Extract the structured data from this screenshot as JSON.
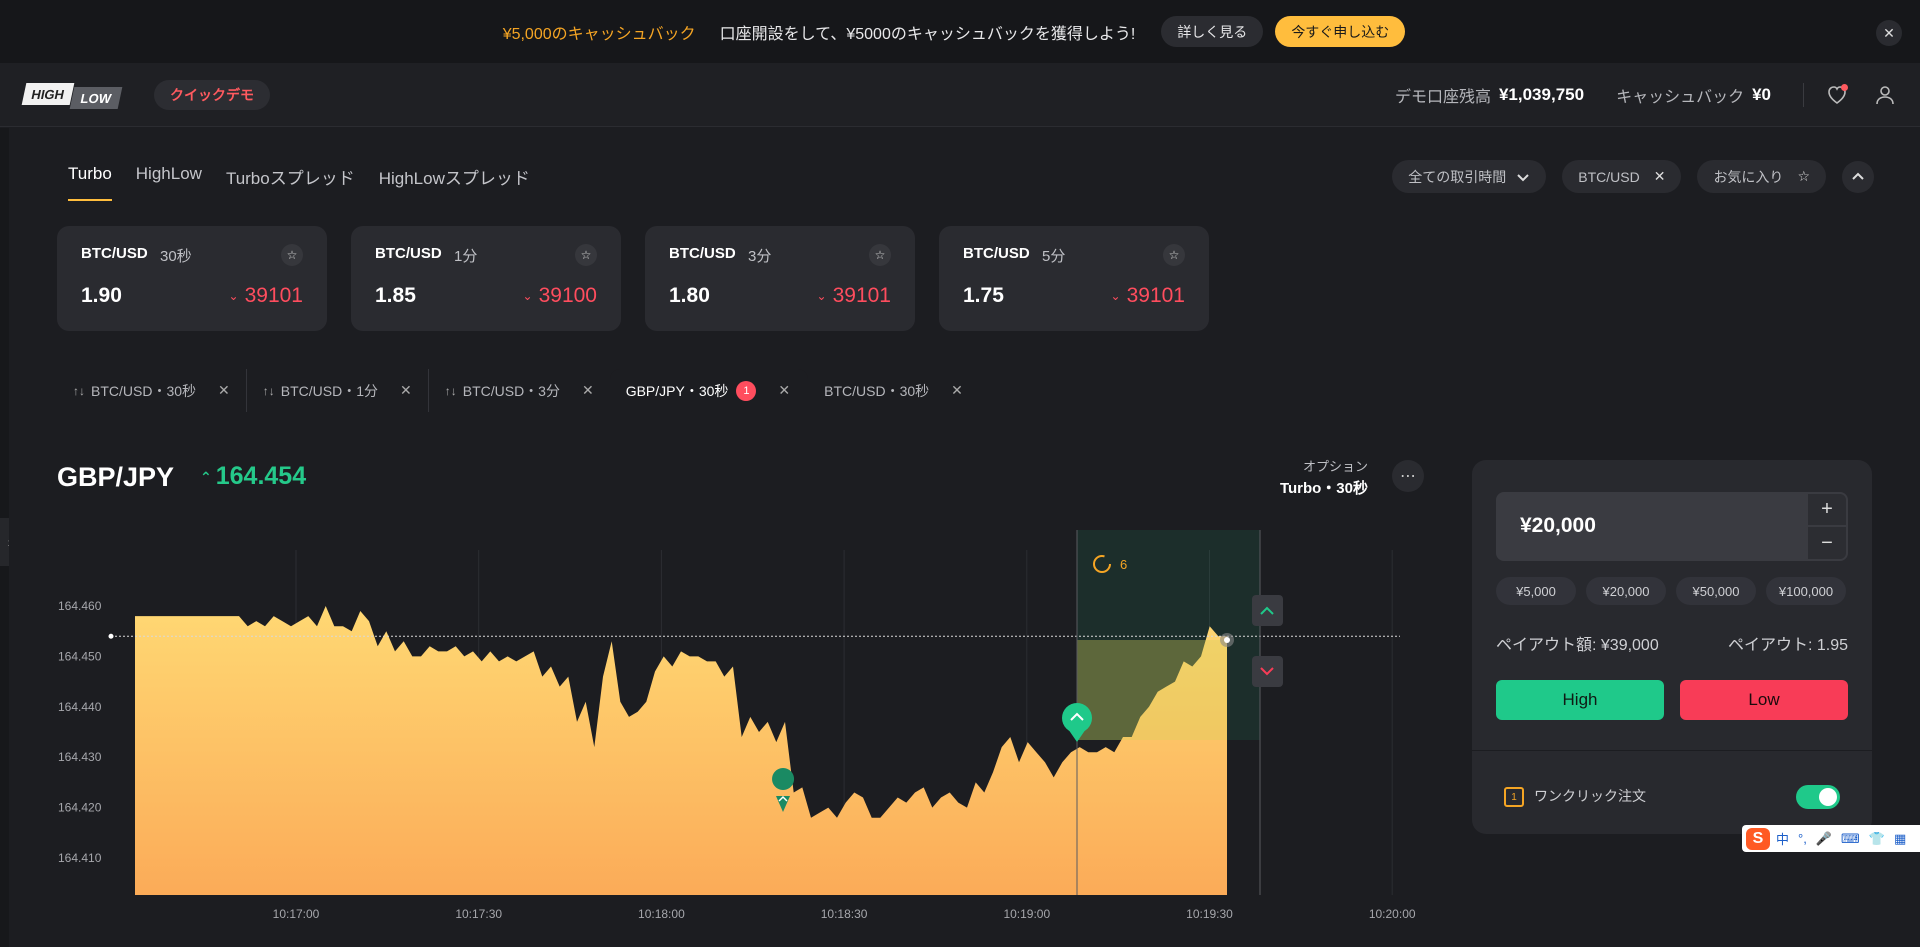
{
  "promo": {
    "title": "¥5,000のキャッシュバック",
    "text": "口座開設をして、¥5000のキャッシュバックを獲得しよう!",
    "details_label": "詳しく見る",
    "apply_label": "今すぐ申し込む",
    "close_label": "✕"
  },
  "header": {
    "logo_high": "HIGH",
    "logo_low": "LOW",
    "quick_demo_label": "クイックデモ",
    "balance_label": "デモ口座残高",
    "balance_value": "¥1,039,750",
    "cashback_label": "キャッシュバック",
    "cashback_value": "¥0"
  },
  "game_tabs": [
    {
      "label": "Turbo",
      "active": true
    },
    {
      "label": "HighLow",
      "active": false
    },
    {
      "label": "Turboスプレッド",
      "active": false
    },
    {
      "label": "HighLowスプレッド",
      "active": false
    }
  ],
  "filters": {
    "time_label": "全ての取引時間",
    "asset_label": "BTC/USD",
    "favorites_label": "お気に入り"
  },
  "cards": [
    {
      "asset": "BTC/USD",
      "duration": "30秒",
      "payout": "1.90",
      "price": "39101"
    },
    {
      "asset": "BTC/USD",
      "duration": "1分",
      "payout": "1.85",
      "price": "39100"
    },
    {
      "asset": "BTC/USD",
      "duration": "3分",
      "payout": "1.80",
      "price": "39101"
    },
    {
      "asset": "BTC/USD",
      "duration": "5分",
      "payout": "1.75",
      "price": "39101"
    }
  ],
  "chart_tabs": [
    {
      "label": "BTC/USD・30秒"
    },
    {
      "label": "BTC/USD・1分"
    },
    {
      "label": "BTC/USD・3分"
    },
    {
      "label": "GBP/JPY・30秒",
      "badge": "1",
      "active": true
    },
    {
      "label": "BTC/USD・30秒"
    }
  ],
  "chart_header": {
    "asset": "GBP/JPY",
    "price": "164.454",
    "option_label": "オプション",
    "option_value": "Turbo・30秒",
    "countdown": "6"
  },
  "chart_data": {
    "type": "area",
    "y_ticks": [
      "164.460",
      "164.450",
      "164.440",
      "164.430",
      "164.420",
      "164.410"
    ],
    "x_ticks": [
      "10:17:00",
      "10:17:30",
      "10:18:00",
      "10:18:30",
      "10:19:00",
      "10:19:30",
      "10:20:00"
    ],
    "ylim": [
      164.404,
      164.466
    ],
    "strike": 164.454,
    "series": [
      {
        "values": [
          164.458,
          164.458,
          164.458,
          164.458,
          164.458,
          164.458,
          164.458,
          164.458,
          164.458,
          164.458,
          164.458,
          164.458,
          164.458,
          164.456,
          164.457,
          164.456,
          164.458,
          164.457,
          164.456,
          164.457,
          164.458,
          164.456,
          164.46,
          164.456,
          164.456,
          164.455,
          164.459,
          164.457,
          164.452,
          164.455,
          164.451,
          164.453,
          164.45,
          164.45,
          164.452,
          164.451,
          164.451,
          164.452,
          164.45,
          164.451,
          164.449,
          164.451,
          164.449,
          164.45,
          164.449,
          164.45,
          164.451,
          164.446,
          164.448,
          164.444,
          164.446,
          164.437,
          164.441,
          164.432,
          164.446,
          164.453,
          164.441,
          164.438,
          164.439,
          164.441,
          164.447,
          164.45,
          164.448,
          164.451,
          164.45,
          164.45,
          164.449,
          164.449,
          164.446,
          164.448,
          164.434,
          164.438,
          164.435,
          164.437,
          164.433,
          164.437,
          164.423,
          164.424,
          164.418,
          164.419,
          164.42,
          164.418,
          164.421,
          164.423,
          164.422,
          164.418,
          164.418,
          164.42,
          164.422,
          164.421,
          164.423,
          164.424,
          164.42,
          164.422,
          164.423,
          164.421,
          164.42,
          164.425,
          164.423,
          164.427,
          164.432,
          164.434,
          164.429,
          164.433,
          164.431,
          164.429,
          164.426,
          164.429,
          164.431,
          164.432,
          164.431,
          164.431,
          164.432,
          164.431,
          164.434,
          164.434,
          164.438,
          164.44,
          164.443,
          164.444,
          164.445,
          164.449,
          164.448,
          164.45,
          164.456,
          164.454,
          164.454
        ]
      }
    ]
  },
  "trade_panel": {
    "amount": "¥20,000",
    "presets": [
      "¥5,000",
      "¥20,000",
      "¥50,000",
      "¥100,000"
    ],
    "payout_amount": "ペイアウト額: ¥39,000",
    "payout_rate": "ペイアウト: 1.95",
    "high_label": "High",
    "low_label": "Low",
    "oneclick_label": "ワンクリック注文",
    "oneclick_on": true
  },
  "ime": {
    "logo": "S",
    "items": [
      "中",
      "°,",
      "🎤",
      "⌨",
      "👕",
      "▦"
    ]
  }
}
